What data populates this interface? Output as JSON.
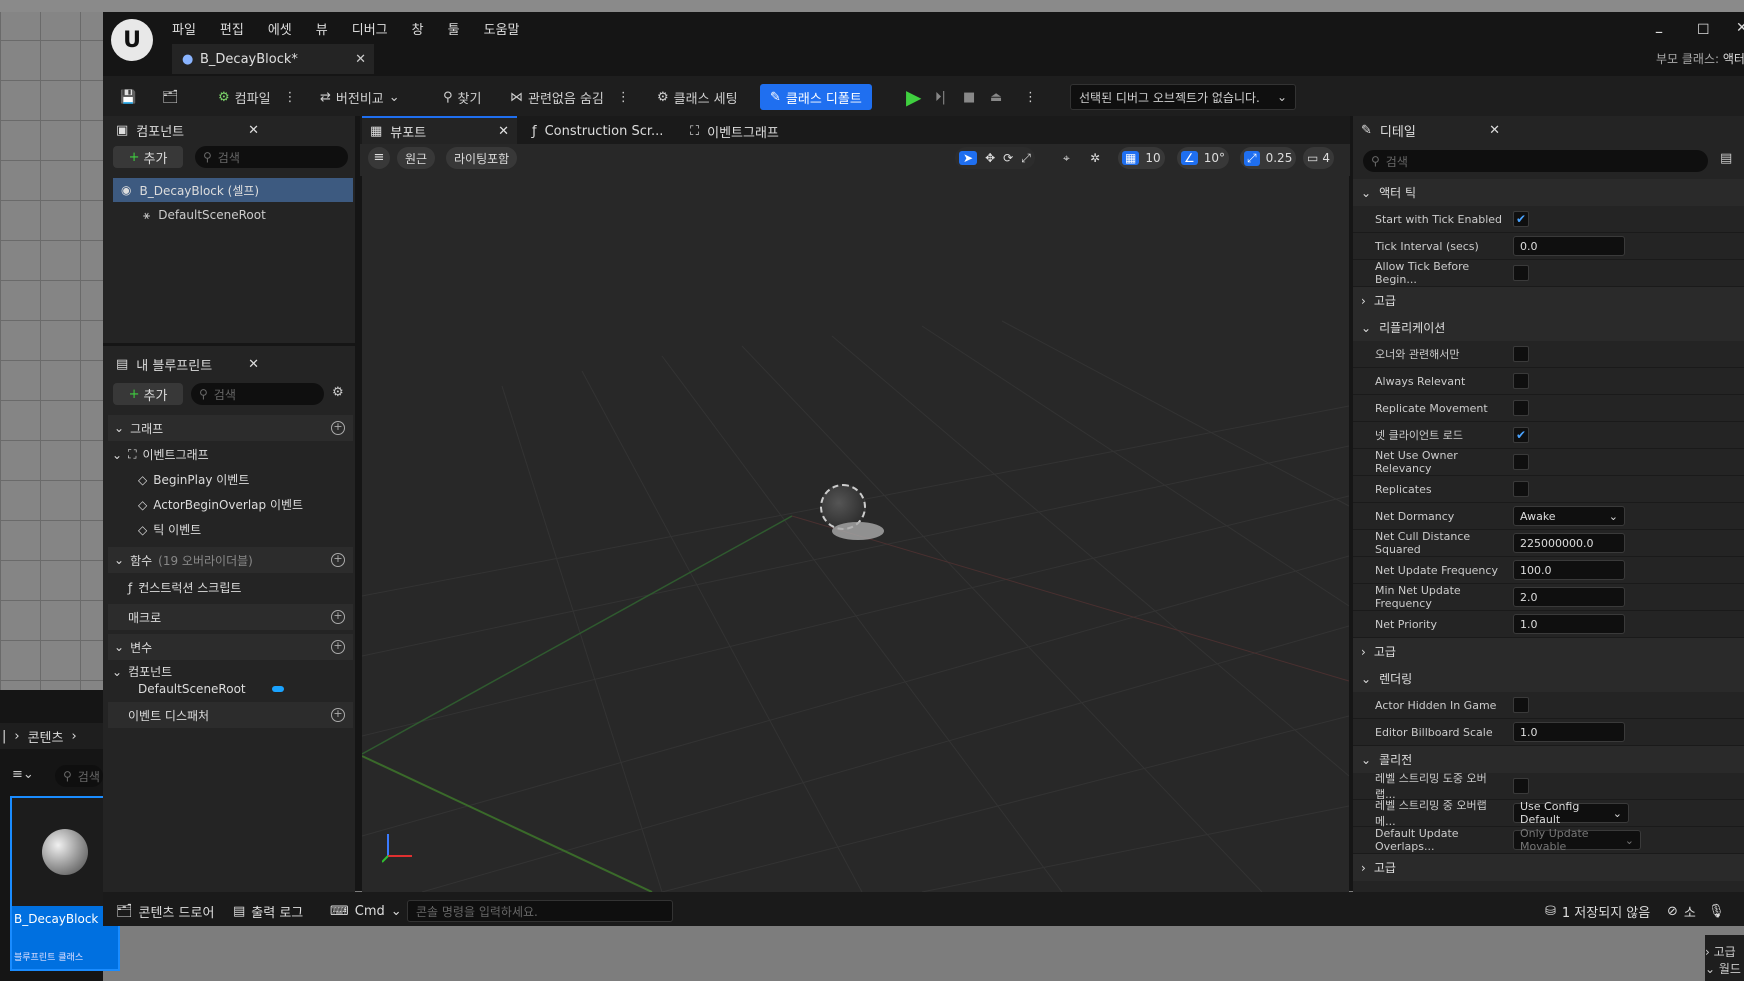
{
  "menu": [
    "파일",
    "편집",
    "에셋",
    "뷰",
    "디버그",
    "창",
    "툴",
    "도움말"
  ],
  "doc_tab": "B_DecayBlock*",
  "parent_class_label": "부모 클래스:",
  "parent_class_value": "액터",
  "toolbar": {
    "compile": "컴파일",
    "diff": "버전비교",
    "find": "찾기",
    "hide_unrelated": "관련없음 숨김",
    "class_settings": "클래스 세팅",
    "class_defaults": "클래스 디폴트",
    "debug_object": "선택된 디버그 오브젝트가 없습니다."
  },
  "components_panel": {
    "title": "컴포넌트",
    "add": "추가",
    "search_placeholder": "검색",
    "root": "B_DecayBlock (셀프)",
    "child": "DefaultSceneRoot"
  },
  "my_blueprint": {
    "title": "내 블루프린트",
    "add": "추가",
    "search_placeholder": "검색",
    "graphs": "그래프",
    "event_graph": "이벤트그래프",
    "events": [
      "BeginPlay 이벤트",
      "ActorBeginOverlap 이벤트",
      "틱 이벤트"
    ],
    "functions": "함수",
    "functions_note": "(19 오버라이더블)",
    "construction_script": "컨스트럭션 스크립트",
    "macros": "매크로",
    "variables": "변수",
    "components": "컴포넌트",
    "default_scene_root": "DefaultSceneRoot",
    "event_dispatchers": "이벤트 디스패처"
  },
  "center_tabs": [
    "뷰포트",
    "Construction Scr...",
    "이벤트그래프"
  ],
  "viewport": {
    "perspective": "원근",
    "lit": "라이팅포함",
    "grid_snap": "10",
    "rot_snap": "10°",
    "scale_snap": "0.25",
    "cam_speed": "4"
  },
  "details": {
    "title": "디테일",
    "search_placeholder": "검색",
    "sections": [
      {
        "name": "액터 틱",
        "rows": [
          {
            "label": "Start with Tick Enabled",
            "type": "check",
            "checked": true
          },
          {
            "label": "Tick Interval (secs)",
            "type": "input",
            "value": "0.0"
          },
          {
            "label": "Allow Tick Before Begin...",
            "type": "check",
            "checked": false
          }
        ]
      },
      {
        "name": "고급",
        "collapsed": true,
        "rows": []
      },
      {
        "name": "리플리케이션",
        "rows": [
          {
            "label": "오너와 관련해서만",
            "type": "check",
            "checked": false
          },
          {
            "label": "Always Relevant",
            "type": "check",
            "checked": false
          },
          {
            "label": "Replicate Movement",
            "type": "check",
            "checked": false
          },
          {
            "label": "넷 클라이언트 로드",
            "type": "check",
            "checked": true
          },
          {
            "label": "Net Use Owner Relevancy",
            "type": "check",
            "checked": false
          },
          {
            "label": "Replicates",
            "type": "check",
            "checked": false
          },
          {
            "label": "Net Dormancy",
            "type": "dropdown",
            "value": "Awake"
          },
          {
            "label": "Net Cull Distance Squared",
            "type": "input",
            "value": "225000000.0"
          },
          {
            "label": "Net Update Frequency",
            "type": "input",
            "value": "100.0"
          },
          {
            "label": "Min Net Update Frequency",
            "type": "input",
            "value": "2.0"
          },
          {
            "label": "Net Priority",
            "type": "input",
            "value": "1.0"
          }
        ]
      },
      {
        "name": "고급",
        "collapsed": true,
        "rows": []
      },
      {
        "name": "렌더링",
        "rows": [
          {
            "label": "Actor Hidden In Game",
            "type": "check",
            "checked": false
          },
          {
            "label": "Editor Billboard Scale",
            "type": "input",
            "value": "1.0"
          }
        ]
      },
      {
        "name": "콜리전",
        "rows": [
          {
            "label": "레벨 스트리밍 도중 오버랩...",
            "type": "check",
            "checked": false
          },
          {
            "label": "레벨 스트리밍 중 오버랩 메...",
            "type": "dropdown",
            "value": "Use Config Default"
          },
          {
            "label": "Default Update Overlaps...",
            "type": "dropdown",
            "value": "Only Update Movable",
            "disabled": true
          }
        ]
      },
      {
        "name": "고급",
        "collapsed": true,
        "rows": []
      }
    ]
  },
  "statusbar": {
    "content_drawer": "콘텐츠 드로어",
    "output_log": "출력 로그",
    "cmd": "Cmd",
    "console_placeholder": "콘솔 명령을 입력하세요.",
    "unsaved": "1 저장되지 않음",
    "source_control": "소"
  },
  "background": {
    "breadcrumb": "콘텐츠",
    "search_placeholder": "검색",
    "asset_name": "B_DecayBlock",
    "asset_type": "블루프린트 클래스",
    "right_labels": [
      "고급",
      "월드"
    ]
  }
}
